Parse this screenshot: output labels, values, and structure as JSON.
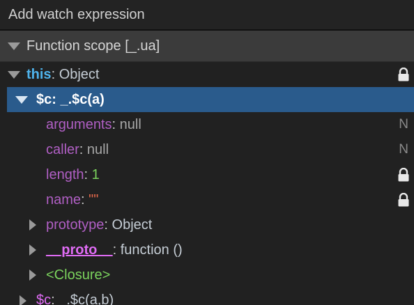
{
  "watch": {
    "label": "Add watch expression"
  },
  "scope": {
    "title": "Function scope [_.ua]"
  },
  "tree": {
    "this_key": "this",
    "this_value": "Object",
    "selected_key": "$c",
    "selected_value": "_.$c(a)",
    "arguments_key": "arguments",
    "arguments_value": "null",
    "arguments_badge": "N",
    "caller_key": "caller",
    "caller_value": "null",
    "caller_badge": "N",
    "length_key": "length",
    "length_value": "1",
    "name_key": "name",
    "name_value": "\"\"",
    "prototype_key": "prototype",
    "prototype_value": "Object",
    "proto_key": "__proto__",
    "proto_value": "function ()",
    "closure_label": "<Closure>",
    "cutoff_key": "$c",
    "cutoff_value": "_.$c(a,b)"
  },
  "separator": ": ",
  "colors": {
    "background": "#212121",
    "section_header": "#3b3b3b",
    "selected_row": "#2a5b8c",
    "keyword": "#4fb3ec",
    "property": "#b05fc4",
    "number": "#7bd35d",
    "string": "#e76a4b"
  }
}
